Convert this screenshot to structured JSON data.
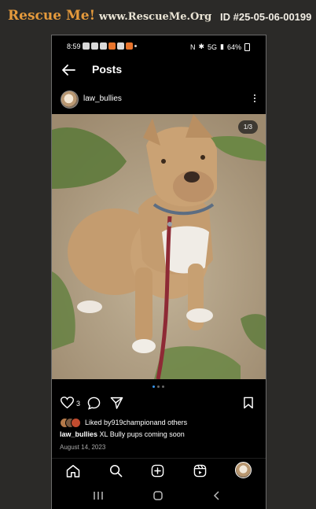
{
  "banner": {
    "brand": "Rescue Me!",
    "site": "www.RescueMe.Org",
    "pet_id": "ID #25-05-06-00199"
  },
  "status_bar": {
    "time": "8:59",
    "network": "5G",
    "battery": "64%"
  },
  "header": {
    "title": "Posts"
  },
  "post": {
    "username": "law_bullies",
    "photo_counter": "1/3",
    "like_count": "3",
    "liked_by_prefix": "Liked by ",
    "liked_by_user": "919champion",
    "liked_by_suffix": " and others",
    "caption_user": "law_bullies",
    "caption_text": " XL Bully pups coming soon",
    "date": "August 14, 2023"
  },
  "colors": {
    "brand_orange": "#e59a3c",
    "active_dot": "#3897f0",
    "background": "#000000"
  },
  "icons": {
    "back": "arrow-left",
    "more": "three-dots-vertical",
    "like": "heart-outline",
    "comment": "speech-bubble",
    "share": "paper-plane",
    "save": "bookmark",
    "home": "home",
    "search": "magnifier",
    "create": "plus-square",
    "reels": "reels",
    "profile": "avatar"
  }
}
